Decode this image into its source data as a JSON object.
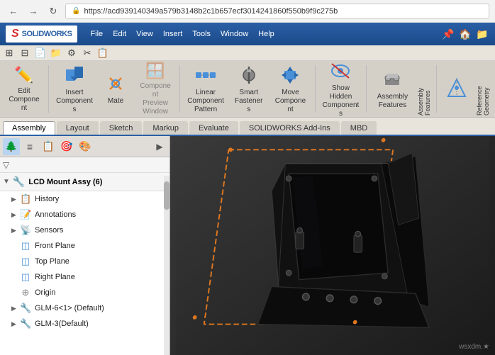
{
  "browser": {
    "back_label": "←",
    "forward_label": "→",
    "refresh_label": "↻",
    "address": "https://acd939140349a579b3148b2c1b657ecf3014241860f550b9f9c275b",
    "lock_icon": "🔒"
  },
  "app": {
    "logo_s": "S",
    "logo_text": "SOLIDWORKS"
  },
  "menu": {
    "items": [
      "File",
      "Edit",
      "View",
      "Insert",
      "Tools",
      "Window",
      "Help"
    ]
  },
  "ribbon_quick": {
    "icons": [
      "⊞",
      "⊟",
      "📄",
      "📁",
      "⚙",
      "✂",
      "📋"
    ]
  },
  "ribbon": {
    "sections": [
      {
        "id": "component",
        "label": "",
        "buttons": [
          {
            "id": "edit-component",
            "icon": "✏",
            "label": "Edit\nComponent"
          }
        ]
      },
      {
        "id": "insert",
        "label": "",
        "buttons": [
          {
            "id": "insert-components",
            "icon": "📦",
            "label": "Insert\nComponents"
          },
          {
            "id": "mate",
            "icon": "🔗",
            "label": "Mate"
          },
          {
            "id": "component-preview",
            "icon": "🪟",
            "label": "Component\nPreview\nWindow"
          },
          {
            "id": "linear-component-pattern",
            "icon": "⊞",
            "label": "Linear Component\nPattern"
          },
          {
            "id": "smart-fasteners",
            "icon": "🔩",
            "label": "Smart\nFasteners"
          },
          {
            "id": "move-component",
            "icon": "↔",
            "label": "Move\nComponent"
          },
          {
            "id": "show-hidden",
            "icon": "👁",
            "label": "Show\nHidden\nComponents"
          }
        ]
      },
      {
        "id": "assembly-features",
        "label": "Assembly Features",
        "buttons": [
          {
            "id": "assembly-features-btn",
            "icon": "⚙",
            "label": ""
          }
        ]
      },
      {
        "id": "reference-geometry",
        "label": "Reference Geometry",
        "buttons": [
          {
            "id": "ref-geometry-btn",
            "icon": "📐",
            "label": ""
          }
        ]
      }
    ]
  },
  "tabs": {
    "items": [
      {
        "id": "assembly",
        "label": "Assembly",
        "active": true
      },
      {
        "id": "layout",
        "label": "Layout",
        "active": false
      },
      {
        "id": "sketch",
        "label": "Sketch",
        "active": false
      },
      {
        "id": "markup",
        "label": "Markup",
        "active": false
      },
      {
        "id": "evaluate",
        "label": "Evaluate",
        "active": false
      },
      {
        "id": "solidworks-addins",
        "label": "SOLIDWORKS Add-Ins",
        "active": false
      },
      {
        "id": "mbd",
        "label": "MBD",
        "active": false
      }
    ]
  },
  "tree": {
    "toolbar_buttons": [
      "🌲",
      "≡",
      "🔄",
      "🎯",
      "🎨"
    ],
    "header": "LCD Mount Assy  (6)",
    "items": [
      {
        "id": "history",
        "icon": "📋",
        "label": "History",
        "arrow": "▶"
      },
      {
        "id": "annotations",
        "icon": "📝",
        "label": "Annotations",
        "arrow": "▶"
      },
      {
        "id": "sensors",
        "icon": "📡",
        "label": "Sensors",
        "arrow": "▶"
      },
      {
        "id": "front-plane",
        "icon": "◫",
        "label": "Front Plane",
        "arrow": ""
      },
      {
        "id": "top-plane",
        "icon": "◫",
        "label": "Top Plane",
        "arrow": ""
      },
      {
        "id": "right-plane",
        "icon": "◫",
        "label": "Right Plane",
        "arrow": ""
      },
      {
        "id": "origin",
        "icon": "⊕",
        "label": "Origin",
        "arrow": ""
      },
      {
        "id": "glm-6-1",
        "icon": "🔧",
        "label": "GLM-6<1> (Default)",
        "arrow": "▶"
      },
      {
        "id": "glm-3",
        "icon": "🔧",
        "label": "GLM-3(Default)",
        "arrow": "▶"
      }
    ]
  },
  "viewport": {
    "watermark": "wsxdm.★"
  }
}
